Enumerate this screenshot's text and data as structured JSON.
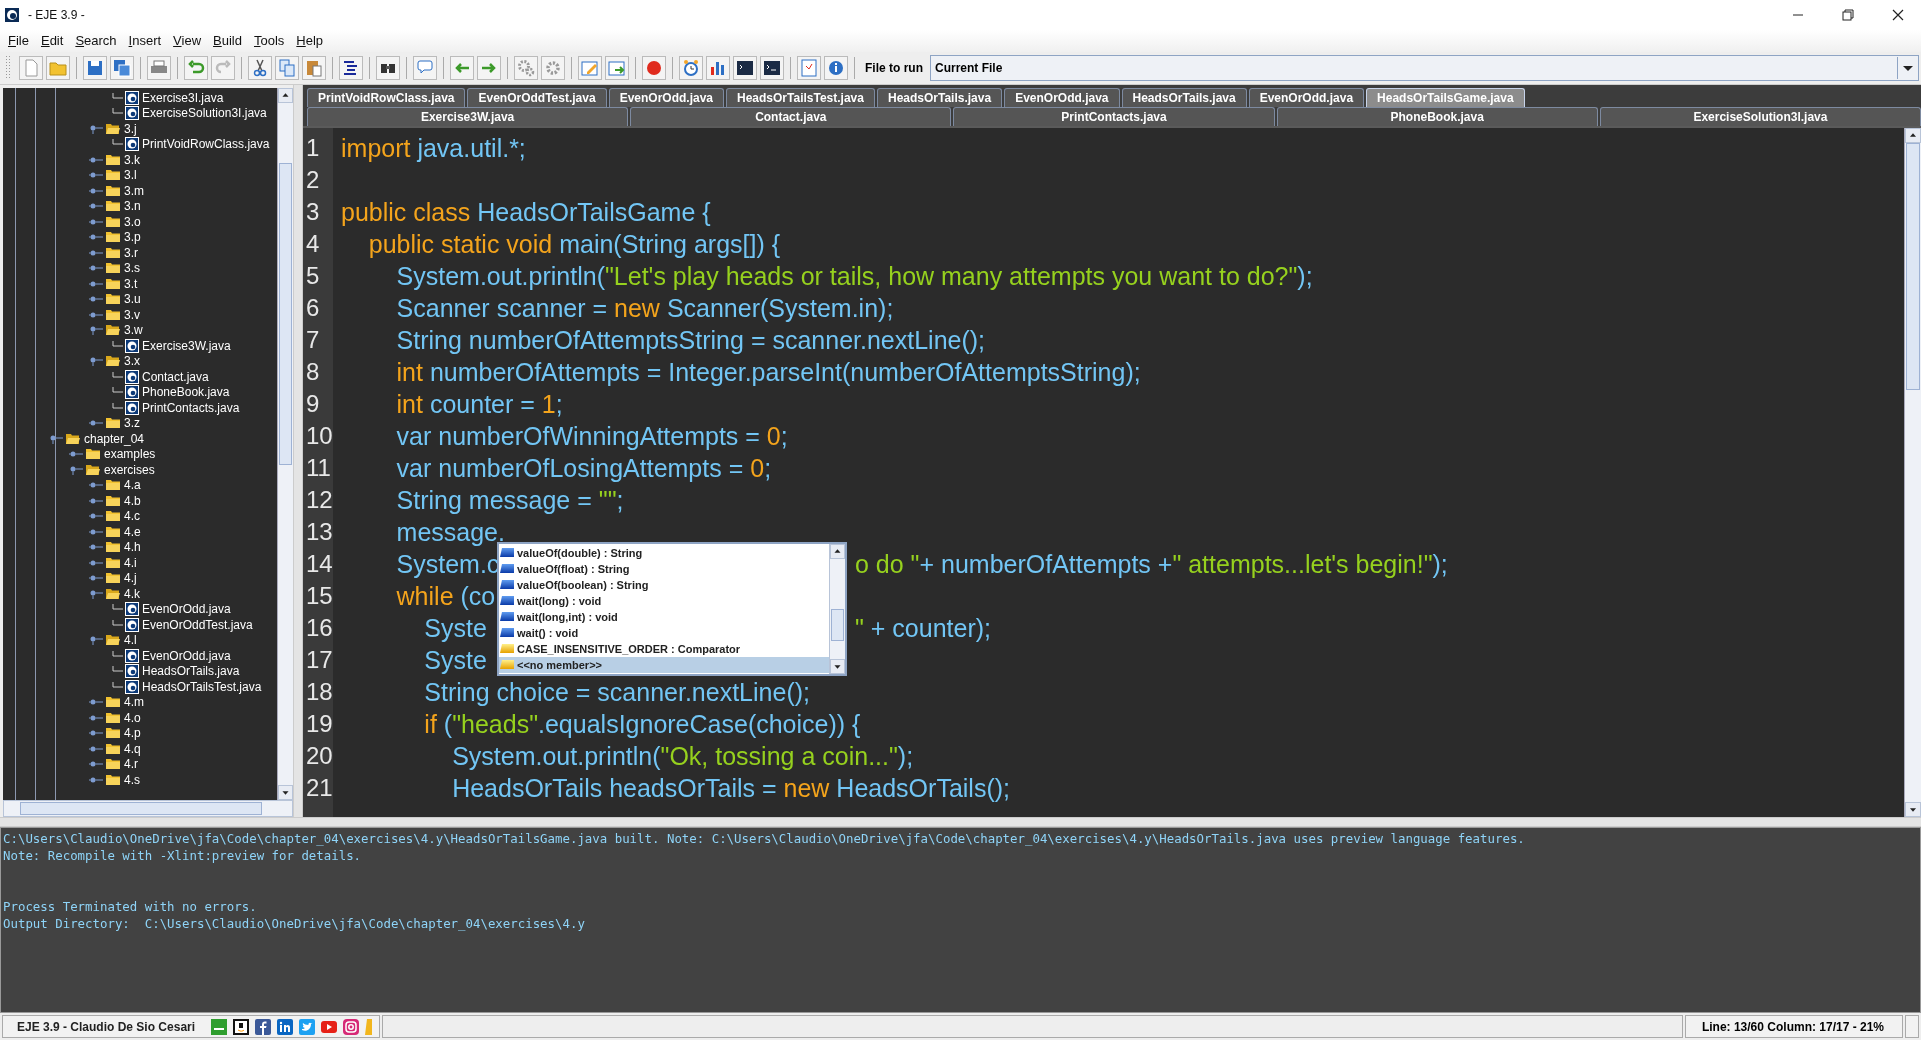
{
  "window": {
    "title": "- EJE 3.9 -"
  },
  "menu": [
    "File",
    "Edit",
    "Search",
    "Insert",
    "View",
    "Build",
    "Tools",
    "Help"
  ],
  "run_selector": {
    "label": "File to run",
    "value": "Current File"
  },
  "tree": [
    {
      "children": [
        {
          "children": [
            {
              "children": [
                {
                  "children": [
                    {
                      "children": [
                        {
                          "label": "Exercise3I.java",
                          "kind": "file"
                        },
                        {
                          "label": "ExerciseSolution3I.java",
                          "kind": "file"
                        }
                      ]
                    },
                    {
                      "label": "3.j",
                      "kind": "folder",
                      "expanded": true,
                      "children": [
                        {
                          "label": "PrintVoidRowClass.java",
                          "kind": "file"
                        }
                      ]
                    },
                    {
                      "label": "3.k",
                      "kind": "folder",
                      "expanded": false
                    },
                    {
                      "label": "3.l",
                      "kind": "folder",
                      "expanded": false
                    },
                    {
                      "label": "3.m",
                      "kind": "folder",
                      "expanded": false
                    },
                    {
                      "label": "3.n",
                      "kind": "folder",
                      "expanded": false
                    },
                    {
                      "label": "3.o",
                      "kind": "folder",
                      "expanded": false
                    },
                    {
                      "label": "3.p",
                      "kind": "folder",
                      "expanded": false
                    },
                    {
                      "label": "3.r",
                      "kind": "folder",
                      "expanded": false
                    },
                    {
                      "label": "3.s",
                      "kind": "folder",
                      "expanded": false
                    },
                    {
                      "label": "3.t",
                      "kind": "folder",
                      "expanded": false
                    },
                    {
                      "label": "3.u",
                      "kind": "folder",
                      "expanded": false
                    },
                    {
                      "label": "3.v",
                      "kind": "folder",
                      "expanded": false
                    },
                    {
                      "label": "3.w",
                      "kind": "folder",
                      "expanded": true,
                      "children": [
                        {
                          "label": "Exercise3W.java",
                          "kind": "file"
                        }
                      ]
                    },
                    {
                      "label": "3.x",
                      "kind": "folder",
                      "expanded": true,
                      "children": [
                        {
                          "label": "Contact.java",
                          "kind": "file"
                        },
                        {
                          "label": "PhoneBook.java",
                          "kind": "file"
                        },
                        {
                          "label": "PrintContacts.java",
                          "kind": "file"
                        }
                      ]
                    },
                    {
                      "label": "3.z",
                      "kind": "folder",
                      "expanded": false
                    }
                  ]
                }
              ]
            },
            {
              "label": "chapter_04",
              "kind": "folder",
              "expanded": true,
              "children": [
                {
                  "label": "examples",
                  "kind": "folder",
                  "expanded": false
                },
                {
                  "label": "exercises",
                  "kind": "folder",
                  "expanded": true,
                  "children": [
                    {
                      "label": "4.a",
                      "kind": "folder",
                      "expanded": false
                    },
                    {
                      "label": "4.b",
                      "kind": "folder",
                      "expanded": false
                    },
                    {
                      "label": "4.c",
                      "kind": "folder",
                      "expanded": false
                    },
                    {
                      "label": "4.e",
                      "kind": "folder",
                      "expanded": false
                    },
                    {
                      "label": "4.h",
                      "kind": "folder",
                      "expanded": false
                    },
                    {
                      "label": "4.i",
                      "kind": "folder",
                      "expanded": false
                    },
                    {
                      "label": "4.j",
                      "kind": "folder",
                      "expanded": false
                    },
                    {
                      "label": "4.k",
                      "kind": "folder",
                      "expanded": true,
                      "children": [
                        {
                          "label": "EvenOrOdd.java",
                          "kind": "file"
                        },
                        {
                          "label": "EvenOrOddTest.java",
                          "kind": "file"
                        }
                      ]
                    },
                    {
                      "label": "4.l",
                      "kind": "folder",
                      "expanded": true,
                      "children": [
                        {
                          "label": "EvenOrOdd.java",
                          "kind": "file"
                        },
                        {
                          "label": "HeadsOrTails.java",
                          "kind": "file"
                        },
                        {
                          "label": "HeadsOrTailsTest.java",
                          "kind": "file"
                        }
                      ]
                    },
                    {
                      "label": "4.m",
                      "kind": "folder",
                      "expanded": false
                    },
                    {
                      "label": "4.o",
                      "kind": "folder",
                      "expanded": false
                    },
                    {
                      "label": "4.p",
                      "kind": "folder",
                      "expanded": false
                    },
                    {
                      "label": "4.q",
                      "kind": "folder",
                      "expanded": false
                    },
                    {
                      "label": "4.r",
                      "kind": "folder",
                      "expanded": false
                    },
                    {
                      "label": "4.s",
                      "kind": "folder",
                      "expanded": false
                    }
                  ]
                }
              ]
            }
          ]
        }
      ]
    }
  ],
  "tabs_row_1": [
    {
      "label": "PrintVoidRowClass.java",
      "selected": false
    },
    {
      "label": "EvenOrOddTest.java",
      "selected": false
    },
    {
      "label": "EvenOrOdd.java",
      "selected": false
    },
    {
      "label": "HeadsOrTailsTest.java",
      "selected": false
    },
    {
      "label": "HeadsOrTails.java",
      "selected": false
    },
    {
      "label": "EvenOrOdd.java",
      "selected": false
    },
    {
      "label": "HeadsOrTails.java",
      "selected": false
    },
    {
      "label": "EvenOrOdd.java",
      "selected": false
    },
    {
      "label": "HeadsOrTailsGame.java",
      "selected": true
    }
  ],
  "tabs_row_2": [
    {
      "label": "Exercise3W.java",
      "selected": false
    },
    {
      "label": "Contact.java",
      "selected": false
    },
    {
      "label": "PrintContacts.java",
      "selected": false
    },
    {
      "label": "PhoneBook.java",
      "selected": false
    },
    {
      "label": "ExerciseSolution3I.java",
      "selected": false
    }
  ],
  "code_lines": [
    {
      "number": "1",
      "tokens": [
        {
          "kind": "keyword",
          "text": "import"
        },
        {
          "kind": "plain",
          "text": " java.util.*;"
        }
      ]
    },
    {
      "number": "2"
    },
    {
      "number": "3",
      "tokens": [
        {
          "kind": "keyword",
          "text": "public class"
        },
        {
          "kind": "plain",
          "text": " HeadsOrTailsGame {"
        }
      ]
    },
    {
      "number": "4",
      "tokens": [
        {
          "kind": "keyword",
          "text": "    public static void"
        },
        {
          "kind": "plain",
          "text": " main(String args[]) {"
        }
      ]
    },
    {
      "number": "5",
      "tokens": [
        {
          "kind": "plain",
          "text": "        System.out.println("
        },
        {
          "kind": "string",
          "text": "\"Let's play heads or tails, how many attempts you want to do?\""
        },
        {
          "kind": "plain",
          "text": ");"
        }
      ]
    },
    {
      "number": "6",
      "tokens": [
        {
          "kind": "plain",
          "text": "        Scanner scanner = "
        },
        {
          "kind": "keyword",
          "text": "new"
        },
        {
          "kind": "plain",
          "text": " Scanner(System.in);"
        }
      ]
    },
    {
      "number": "7",
      "tokens": [
        {
          "kind": "plain",
          "text": "        String numberOfAttemptsString = scanner.nextLine();"
        }
      ]
    },
    {
      "number": "8",
      "tokens": [
        {
          "kind": "keyword",
          "text": "        int"
        },
        {
          "kind": "plain",
          "text": " numberOfAttempts = Integer.parseInt(numberOfAttemptsString);"
        }
      ]
    },
    {
      "number": "9",
      "tokens": [
        {
          "kind": "keyword",
          "text": "        int"
        },
        {
          "kind": "plain",
          "text": " counter = "
        },
        {
          "kind": "number",
          "text": "1"
        },
        {
          "kind": "plain",
          "text": ";"
        }
      ]
    },
    {
      "number": "10",
      "tokens": [
        {
          "kind": "plain",
          "text": "        var numberOfWinningAttempts = "
        },
        {
          "kind": "number",
          "text": "0"
        },
        {
          "kind": "plain",
          "text": ";"
        }
      ]
    },
    {
      "number": "11",
      "tokens": [
        {
          "kind": "plain",
          "text": "        var numberOfLosingAttempts = "
        },
        {
          "kind": "number",
          "text": "0"
        },
        {
          "kind": "plain",
          "text": ";"
        }
      ]
    },
    {
      "number": "12",
      "tokens": [
        {
          "kind": "plain",
          "text": "        String message = "
        },
        {
          "kind": "string",
          "text": "\"\""
        },
        {
          "kind": "plain",
          "text": ";"
        }
      ]
    },
    {
      "number": "13",
      "tokens": [
        {
          "kind": "plain",
          "text": "        message."
        }
      ]
    },
    {
      "number": "14",
      "tokens": [
        {
          "kind": "plain",
          "text": "        System.c"
        }
      ],
      "right_tokens": [
        {
          "kind": "string",
          "text": "o do \""
        },
        {
          "kind": "plain",
          "text": "+ numberOfAttempts +"
        },
        {
          "kind": "string",
          "text": "\" attempts...let's begin!\""
        },
        {
          "kind": "plain",
          "text": ");"
        }
      ]
    },
    {
      "number": "15",
      "tokens": [
        {
          "kind": "keyword",
          "text": "        while"
        },
        {
          "kind": "plain",
          "text": " (co"
        }
      ]
    },
    {
      "number": "16",
      "tokens": [
        {
          "kind": "plain",
          "text": "            Syste"
        }
      ],
      "right_tokens": [
        {
          "kind": "string",
          "text": "\""
        },
        {
          "kind": "plain",
          "text": " + counter);"
        }
      ]
    },
    {
      "number": "17",
      "tokens": [
        {
          "kind": "plain",
          "text": "            Syste"
        }
      ]
    },
    {
      "number": "18",
      "tokens": [
        {
          "kind": "plain",
          "text": "            String choice = scanner.nextLine();"
        }
      ]
    },
    {
      "number": "19",
      "tokens": [
        {
          "kind": "keyword",
          "text": "            if"
        },
        {
          "kind": "plain",
          "text": " ("
        },
        {
          "kind": "string",
          "text": "\"heads\""
        },
        {
          "kind": "plain",
          "text": ".equalsIgnoreCase(choice)) {"
        }
      ]
    },
    {
      "number": "20",
      "tokens": [
        {
          "kind": "plain",
          "text": "                System.out.println("
        },
        {
          "kind": "string",
          "text": "\"Ok, tossing a coin...\""
        },
        {
          "kind": "plain",
          "text": ");"
        }
      ]
    },
    {
      "number": "21",
      "tokens": [
        {
          "kind": "plain",
          "text": "                HeadsOrTails headsOrTails = "
        },
        {
          "kind": "keyword",
          "text": "new"
        },
        {
          "kind": "plain",
          "text": " HeadsOrTails();"
        }
      ]
    }
  ],
  "completion_popup": {
    "items": [
      {
        "label": "valueOf(double) : String",
        "kind": "method",
        "selected": false
      },
      {
        "label": "valueOf(float) : String",
        "kind": "method",
        "selected": false
      },
      {
        "label": "valueOf(boolean) : String",
        "kind": "method",
        "selected": false
      },
      {
        "label": "wait(long) : void",
        "kind": "method",
        "selected": false
      },
      {
        "label": "wait(long,int) : void",
        "kind": "method",
        "selected": false
      },
      {
        "label": "wait() : void",
        "kind": "method",
        "selected": false
      },
      {
        "label": "CASE_INSENSITIVE_ORDER : Comparator",
        "kind": "field",
        "selected": false
      },
      {
        "label": "<<no member>>",
        "kind": "field",
        "selected": true
      }
    ]
  },
  "console": {
    "blocks": [
      [
        "C:\\Users\\Claudio\\OneDrive\\jfa\\Code\\chapter_04\\exercises\\4.y\\HeadsOrTailsGame.java built. Note: C:\\Users\\Claudio\\OneDrive\\jfa\\Code\\chapter_04\\exercises\\4.y\\HeadsOrTails.java uses preview language features.",
        "Note: Recompile with -Xlint:preview for details."
      ],
      [
        "Process Terminated with no errors.",
        "Output Directory:  C:\\Users\\Claudio\\OneDrive\\jfa\\Code\\chapter_04\\exercises\\4.y"
      ]
    ]
  },
  "status_bar": {
    "credit": "EJE 3.9 - Claudio De Sio Cesari",
    "position": "Line: 13/60 Column: 17/17 - 21%"
  }
}
